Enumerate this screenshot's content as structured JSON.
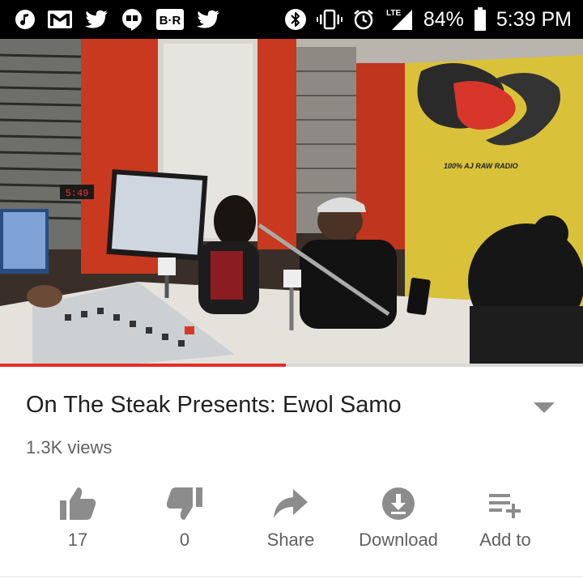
{
  "status_bar": {
    "left_icons": [
      "music-note-icon",
      "gmail-icon",
      "twitter-icon",
      "hangouts-icon",
      "bleacher-report-icon",
      "twitter-icon"
    ],
    "bleacher_report_text": "B·R",
    "right_icons": [
      "bluetooth-icon",
      "vibrate-icon",
      "alarm-icon",
      "lte-signal-icon",
      "battery-icon"
    ],
    "network_label": "LTE",
    "battery": "84%",
    "time": "5:39 PM"
  },
  "video": {
    "progress_fraction": 0.49,
    "watermark_caption": "100% AJ RAW RADIO",
    "clock_readout": "5:49",
    "colors": {
      "progress": "#e52d27",
      "wall_red": "#c8391f",
      "wall_yellow": "#d9c239"
    }
  },
  "details": {
    "title": "On The Steak Presents: Ewol Samo",
    "views": "1.3K views"
  },
  "actions": [
    {
      "icon": "thumbs-up-icon",
      "label": "17"
    },
    {
      "icon": "thumbs-down-icon",
      "label": "0"
    },
    {
      "icon": "share-icon",
      "label": "Share"
    },
    {
      "icon": "download-icon",
      "label": "Download"
    },
    {
      "icon": "add-to-playlist-icon",
      "label": "Add to"
    }
  ],
  "colors": {
    "text_primary": "#212121",
    "text_secondary": "#616161",
    "icon_gray": "#8c8c8c"
  }
}
